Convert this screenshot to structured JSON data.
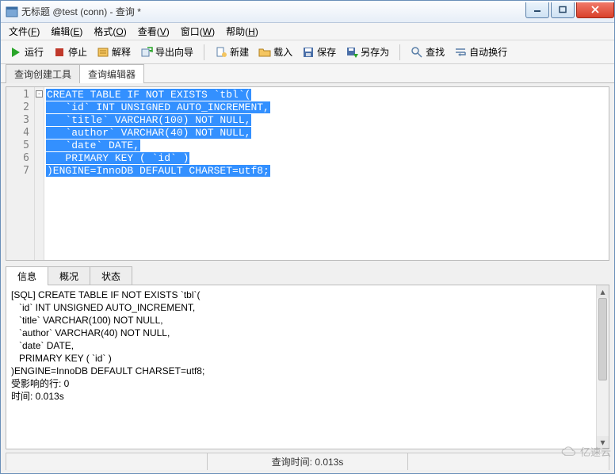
{
  "window": {
    "title": "无标题 @test (conn) - 查询 *"
  },
  "menu": {
    "file": {
      "label": "文件",
      "key": "F"
    },
    "edit": {
      "label": "编辑",
      "key": "E"
    },
    "format": {
      "label": "格式",
      "key": "O"
    },
    "view": {
      "label": "查看",
      "key": "V"
    },
    "window": {
      "label": "窗口",
      "key": "W"
    },
    "help": {
      "label": "帮助",
      "key": "H"
    }
  },
  "toolbar": {
    "run": "运行",
    "stop": "停止",
    "explain": "解释",
    "export": "导出向导",
    "new": "新建",
    "load": "载入",
    "save": "保存",
    "saveAs": "另存为",
    "find": "查找",
    "wrap": "自动换行"
  },
  "tabs": {
    "builder": "查询创建工具",
    "editor": "查询编辑器",
    "activeIndex": 1
  },
  "code": {
    "lines": [
      "CREATE TABLE IF NOT EXISTS `tbl`(",
      "   `id` INT UNSIGNED AUTO_INCREMENT,",
      "   `title` VARCHAR(100) NOT NULL,",
      "   `author` VARCHAR(40) NOT NULL,",
      "   `date` DATE,",
      "   PRIMARY KEY ( `id` )",
      ")ENGINE=InnoDB DEFAULT CHARSET=utf8;"
    ],
    "selectedAll": true
  },
  "resultTabs": {
    "info": "信息",
    "profile": "概况",
    "state": "状态",
    "activeIndex": 0
  },
  "result": {
    "lines": [
      "[SQL] CREATE TABLE IF NOT EXISTS `tbl`(",
      "   `id` INT UNSIGNED AUTO_INCREMENT,",
      "   `title` VARCHAR(100) NOT NULL,",
      "   `author` VARCHAR(40) NOT NULL,",
      "   `date` DATE,",
      "   PRIMARY KEY ( `id` )",
      ")ENGINE=InnoDB DEFAULT CHARSET=utf8;",
      "受影响的行: 0",
      "时间: 0.013s"
    ]
  },
  "status": {
    "queryTime": "查询时间: 0.013s"
  },
  "watermark": "亿速云"
}
